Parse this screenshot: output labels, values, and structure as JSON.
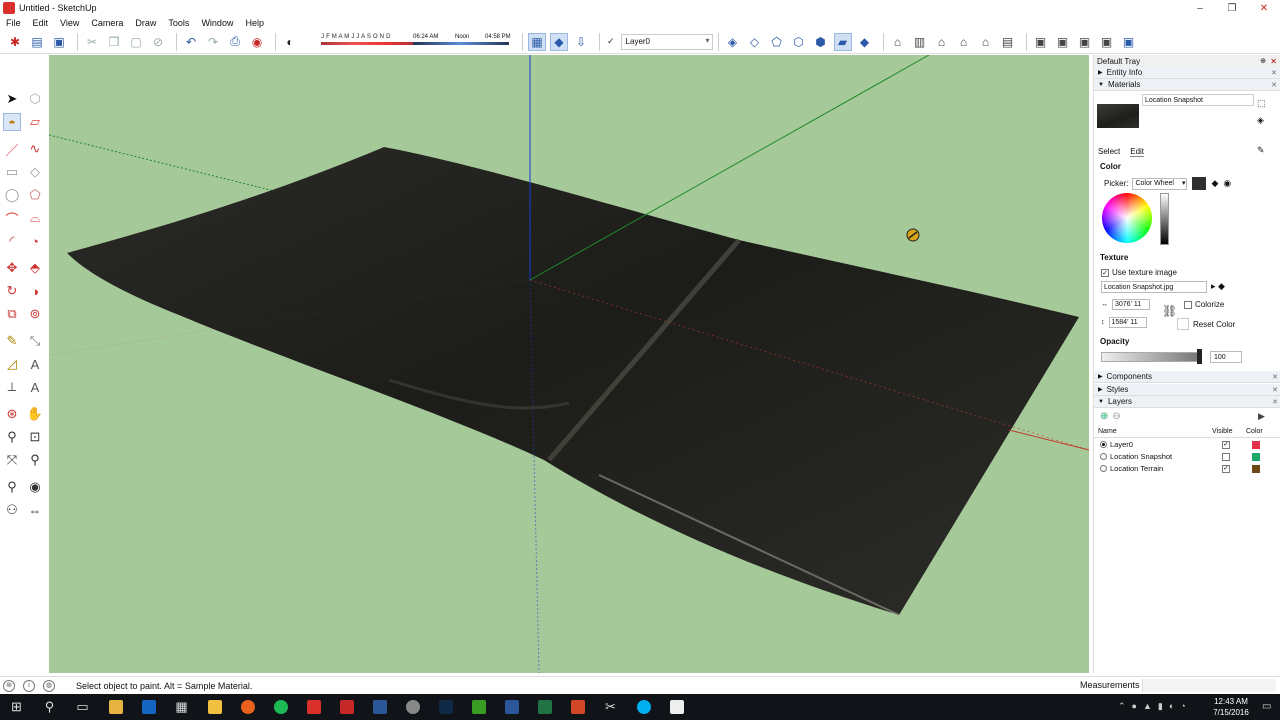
{
  "window": {
    "title": "Untitled - SketchUp",
    "controls": [
      "–",
      "❐",
      "✕"
    ]
  },
  "menu": [
    "File",
    "Edit",
    "View",
    "Camera",
    "Draw",
    "Tools",
    "Window",
    "Help"
  ],
  "toolbar": {
    "shadow_months": "J F M A M J J A S O N D",
    "time_start": "06:24 AM",
    "time_mid": "Noon",
    "time_end": "04:58 PM",
    "layer": "Layer0"
  },
  "tray": {
    "title": "Default Tray",
    "entity_info": "Entity Info",
    "materials": "Materials",
    "material_name": "Location Snapshot",
    "tab_select": "Select",
    "tab_edit": "Edit",
    "color_label": "Color",
    "picker_label": "Picker:",
    "picker_value": "Color Wheel",
    "texture_label": "Texture",
    "use_texture_label": "Use texture image",
    "texture_file": "Location Snapshot.jpg",
    "width_value": "3076' 11",
    "height_value": "1584' 11",
    "colorize_label": "Colorize",
    "reset_color_label": "Reset Color",
    "opacity_label": "Opacity",
    "opacity_value": "100",
    "components": "Components",
    "styles": "Styles",
    "layers": "Layers",
    "col_name": "Name",
    "col_visible": "Visible",
    "col_color": "Color",
    "layer_rows": [
      {
        "name": "Layer0",
        "active": true,
        "visible": true,
        "color": "#e0304a"
      },
      {
        "name": "Location Snapshot",
        "active": false,
        "visible": false,
        "color": "#1fa86b"
      },
      {
        "name": "Location Terrain",
        "active": false,
        "visible": true,
        "color": "#6b4a12"
      }
    ]
  },
  "status": {
    "hint": "Select object to paint. Alt = Sample Material.",
    "measurements_label": "Measurements"
  },
  "taskbar": {
    "time": "12:43 AM",
    "date": "7/15/2016"
  },
  "colors": {
    "viewport_background": "#a6c99a",
    "terrain": "#1f1f1b",
    "axis_red": "#c0392b",
    "axis_green": "#1e8b2a",
    "axis_blue": "#1a3dd0"
  }
}
